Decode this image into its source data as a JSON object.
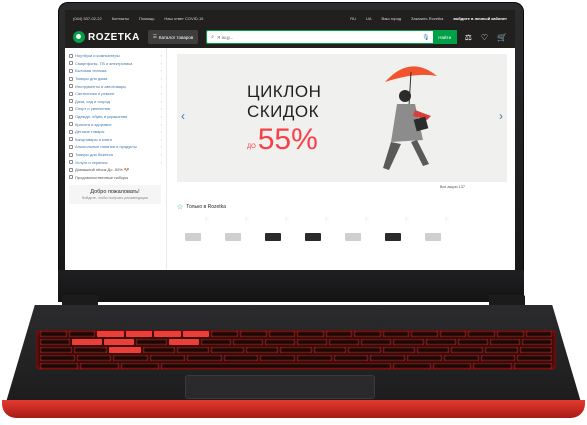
{
  "topbar": {
    "phone": "(044) 537-02-22",
    "links": [
      "Контакты",
      "Помощь",
      "Наш ответ COVID-19"
    ],
    "langs": [
      "RU",
      "UA"
    ],
    "shop_link": "Ваш город",
    "order": "Заказать Rozetka",
    "login": "войдите в личный кабинет"
  },
  "header": {
    "logo": "ROZETKA",
    "catalog": "Каталог товаров",
    "search_placeholder": "Я ищу...",
    "find": "Найти"
  },
  "sidebar": {
    "items": [
      {
        "label": "Ноутбуки и компьютеры"
      },
      {
        "label": "Смартфоны, ТВ и электроника"
      },
      {
        "label": "Бытовая техника"
      },
      {
        "label": "Товары для дома"
      },
      {
        "label": "Инструменты и автотовары"
      },
      {
        "label": "Сантехника и ремонт"
      },
      {
        "label": "Дача, сад и огород"
      },
      {
        "label": "Спорт и увлечения"
      },
      {
        "label": "Одежда, обувь и украшения"
      },
      {
        "label": "Красота и здоровье"
      },
      {
        "label": "Детские товары"
      },
      {
        "label": "Канцтовары и книги"
      },
      {
        "label": "Алкогольные напитки и продукты"
      },
      {
        "label": "Товары для бизнеса"
      },
      {
        "label": "Услуги и сервисы"
      },
      {
        "label": "Домашний пёсик До -50% 🐶"
      },
      {
        "label": "Продовольственные наборы"
      }
    ],
    "welcome_title": "Добро пожаловать!",
    "welcome_text": "Войдите, чтобы получать рекомендации"
  },
  "banner": {
    "line1": "ЦИКЛОН",
    "line2": "СКИДОК",
    "do": "ДО",
    "percent": "55%"
  },
  "all_actions": "Все акции 137",
  "section_title": "Только в Rozetka",
  "colors": {
    "accent": "#00a046",
    "sale": "#f84147",
    "link": "#3e77aa"
  }
}
